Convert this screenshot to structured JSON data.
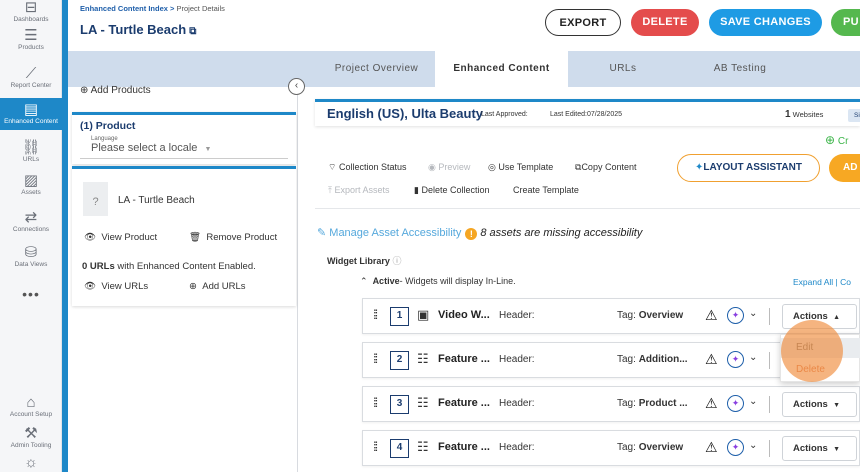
{
  "rail": {
    "items": [
      {
        "label": "Dashboards",
        "icon": "dashboard-icon",
        "glyph": "⊟"
      },
      {
        "label": "Products",
        "icon": "products-icon",
        "glyph": "☰"
      },
      {
        "label": "Report Center",
        "icon": "report-icon",
        "glyph": "⟋"
      },
      {
        "label": "Enhanced Content",
        "icon": "enhanced-content-icon",
        "glyph": "▤"
      },
      {
        "label": "URLs",
        "icon": "link-icon",
        "glyph": "⛓"
      },
      {
        "label": "Assets",
        "icon": "image-icon",
        "glyph": "▨"
      },
      {
        "label": "Connections",
        "icon": "connections-icon",
        "glyph": "⇄"
      },
      {
        "label": "Data Views",
        "icon": "database-icon",
        "glyph": "⛁"
      }
    ],
    "more": "•••",
    "bottom": [
      {
        "label": "Account Setup",
        "icon": "account-icon",
        "glyph": "⌂"
      },
      {
        "label": "Admin Tooling",
        "icon": "wrench-icon",
        "glyph": "⚒"
      },
      {
        "label": "",
        "icon": "bug-icon",
        "glyph": "☼"
      }
    ]
  },
  "header": {
    "breadcrumb_root": "Enhanced Content Index",
    "breadcrumb_sep": ">",
    "breadcrumb_current": "Project Details",
    "title": "LA - Turtle Beach",
    "title_icon": "external-link-icon",
    "export": "EXPORT",
    "delete": "DELETE",
    "save": "SAVE CHANGES",
    "publish": "PU"
  },
  "tabs": [
    "Project Overview",
    "Enhanced Content",
    "URLs",
    "AB Testing"
  ],
  "left_panel": {
    "add_products": "Add Products",
    "product_title": "(1) Product",
    "language_label": "Language",
    "language_placeholder": "Please select a locale",
    "product_name": "LA - Turtle Beach",
    "thumb_glyph": "?",
    "view_product": "View Product",
    "remove_product": "Remove Product",
    "urls_count": "0 URLs",
    "urls_text": "with Enhanced Content Enabled.",
    "view_urls": "View URLs",
    "add_urls": "Add URLs"
  },
  "locale": {
    "name": "English (US), Ulta Beauty",
    "last_approved": "Last Approved:",
    "last_edited": "Last Edited:07/28/2025",
    "websites_count": "1",
    "websites_label": "Websites",
    "single": "Sing",
    "create": "Cr"
  },
  "actions": {
    "collection_status": "Collection Status",
    "preview": "Preview",
    "use_template": "Use Template",
    "copy_content": "Copy Content",
    "export_assets": "Export Assets",
    "delete_collection": "Delete Collection",
    "create_template": "Create Template",
    "layout_assistant": "LAYOUT ASSISTANT",
    "add": "AD"
  },
  "accessibility": {
    "manage": "Manage Asset Accessibility",
    "warning": "!",
    "missing": "8 assets are missing accessibility"
  },
  "widget_library": {
    "title": "Widget Library",
    "help": "ⓘ",
    "active_label": "Active",
    "active_text": "- Widgets will display In-Line.",
    "expand": "Expand All | Co",
    "rows": [
      {
        "num": "1",
        "name": "Video W...",
        "header": "Header:",
        "tag_label": "Tag:",
        "tag": "Overview",
        "actions": "Actions",
        "caret": "▲",
        "icon": "video-widget-icon"
      },
      {
        "num": "2",
        "name": "Feature ...",
        "header": "Header:",
        "tag_label": "Tag:",
        "tag": "Addition...",
        "actions": "Actions",
        "caret": "▼",
        "icon": "feature-widget-icon"
      },
      {
        "num": "3",
        "name": "Feature ...",
        "header": "Header:",
        "tag_label": "Tag:",
        "tag": "Product ...",
        "actions": "Actions",
        "caret": "▼",
        "icon": "feature-widget-icon"
      },
      {
        "num": "4",
        "name": "Feature ...",
        "header": "Header:",
        "tag_label": "Tag:",
        "tag": "Overview",
        "actions": "Actions",
        "caret": "▼",
        "icon": "feature-widget-icon"
      }
    ],
    "menu": {
      "edit": "Edit",
      "delete": "Delete"
    }
  }
}
